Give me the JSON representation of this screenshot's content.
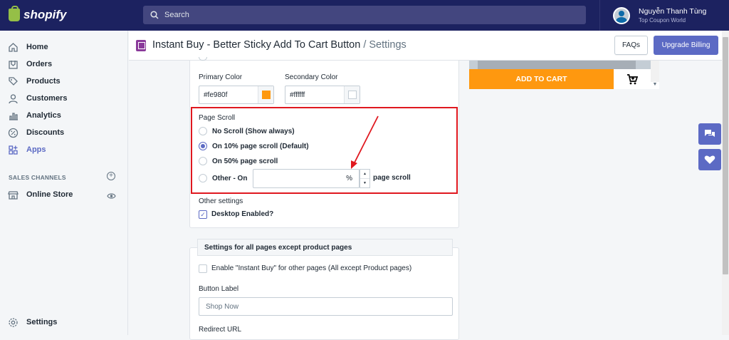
{
  "topbar": {
    "logo_text": "shopify",
    "search_placeholder": "Search",
    "user_name": "Nguyễn Thanh Tùng",
    "store_name": "Top Coupon World"
  },
  "sidebar": {
    "items": [
      {
        "label": "Home",
        "icon": "home-icon"
      },
      {
        "label": "Orders",
        "icon": "orders-icon"
      },
      {
        "label": "Products",
        "icon": "tag-icon"
      },
      {
        "label": "Customers",
        "icon": "person-icon"
      },
      {
        "label": "Analytics",
        "icon": "bar-chart-icon"
      },
      {
        "label": "Discounts",
        "icon": "discount-icon"
      },
      {
        "label": "Apps",
        "icon": "apps-icon"
      }
    ],
    "sales_channels_heading": "SALES CHANNELS",
    "online_store_label": "Online Store",
    "settings_label": "Settings"
  },
  "titlebar": {
    "app_name": "Instant Buy - Better Sticky Add To Cart Button",
    "separator": " / ",
    "page": "Settings",
    "faqs_label": "FAQs",
    "billing_label": "Upgrade Billing"
  },
  "colors_section": {
    "primary_label": "Primary Color",
    "primary_value": "#fe980f",
    "secondary_label": "Secondary Color",
    "secondary_value": "#ffffff"
  },
  "page_scroll": {
    "heading": "Page Scroll",
    "options": [
      {
        "label": "No Scroll (Show always)",
        "selected": false
      },
      {
        "label": "On 10% page scroll (Default)",
        "selected": true
      },
      {
        "label": "On 50% page scroll",
        "selected": false
      },
      {
        "label": "Other - On",
        "selected": false
      }
    ],
    "percent_unit": "%",
    "suffix": "page scroll"
  },
  "other_settings": {
    "heading": "Other settings",
    "desktop_label": "Desktop Enabled?",
    "desktop_checked": true
  },
  "all_pages": {
    "heading": "Settings for all pages except product pages",
    "enable_label": "Enable \"Instant Buy\" for other pages (All except Product pages)",
    "button_label_heading": "Button Label",
    "button_label_placeholder": "Shop Now",
    "redirect_heading": "Redirect URL"
  },
  "preview": {
    "add_to_cart_label": "ADD TO CART",
    "button_color": "#fe980f"
  },
  "accents": {
    "brand": "#5c6ac4",
    "topbar": "#1c2260",
    "highlight": "#e0181f"
  }
}
